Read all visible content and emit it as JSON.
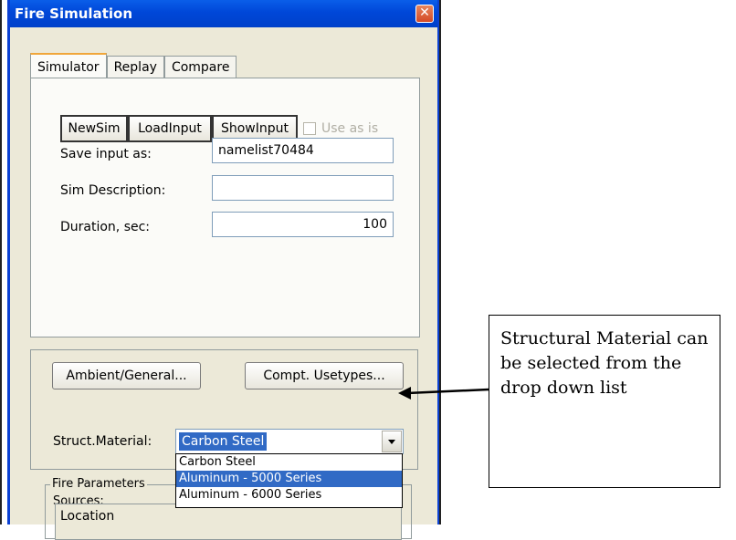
{
  "window": {
    "title": "Fire Simulation",
    "close_glyph": "✕"
  },
  "tabs": [
    {
      "label": "Simulator",
      "active": true
    },
    {
      "label": "Replay",
      "active": false
    },
    {
      "label": "Compare",
      "active": false
    }
  ],
  "toolbar": {
    "newsim": "NewSim",
    "loadinput": "LoadInput",
    "showinput": "ShowInput",
    "use_as_is": "Use as is"
  },
  "fields": {
    "save_label": "Save input as:",
    "save_value": "namelist70484",
    "desc_label": "Sim Description:",
    "desc_value": "",
    "duration_label": "Duration, sec:",
    "duration_value": "100"
  },
  "general": {
    "ambient_button": "Ambient/General...",
    "usetypes_button": "Compt. Usetypes...",
    "material_label": "Struct.Material:",
    "material_selected": "Carbon Steel",
    "options": [
      "Carbon Steel",
      "Aluminum - 5000 Series",
      "Aluminum - 6000 Series"
    ],
    "highlighted_option_index": 1
  },
  "fire": {
    "group_title": "Fire Parameters",
    "sources_label": "Sources:",
    "location_label": "Location"
  },
  "annotation": {
    "text": "Structural Material can be selected from the drop down list"
  },
  "colors": {
    "titlebar": "#0047d8",
    "selection": "#316ac5",
    "window_bg": "#ece9d8"
  }
}
